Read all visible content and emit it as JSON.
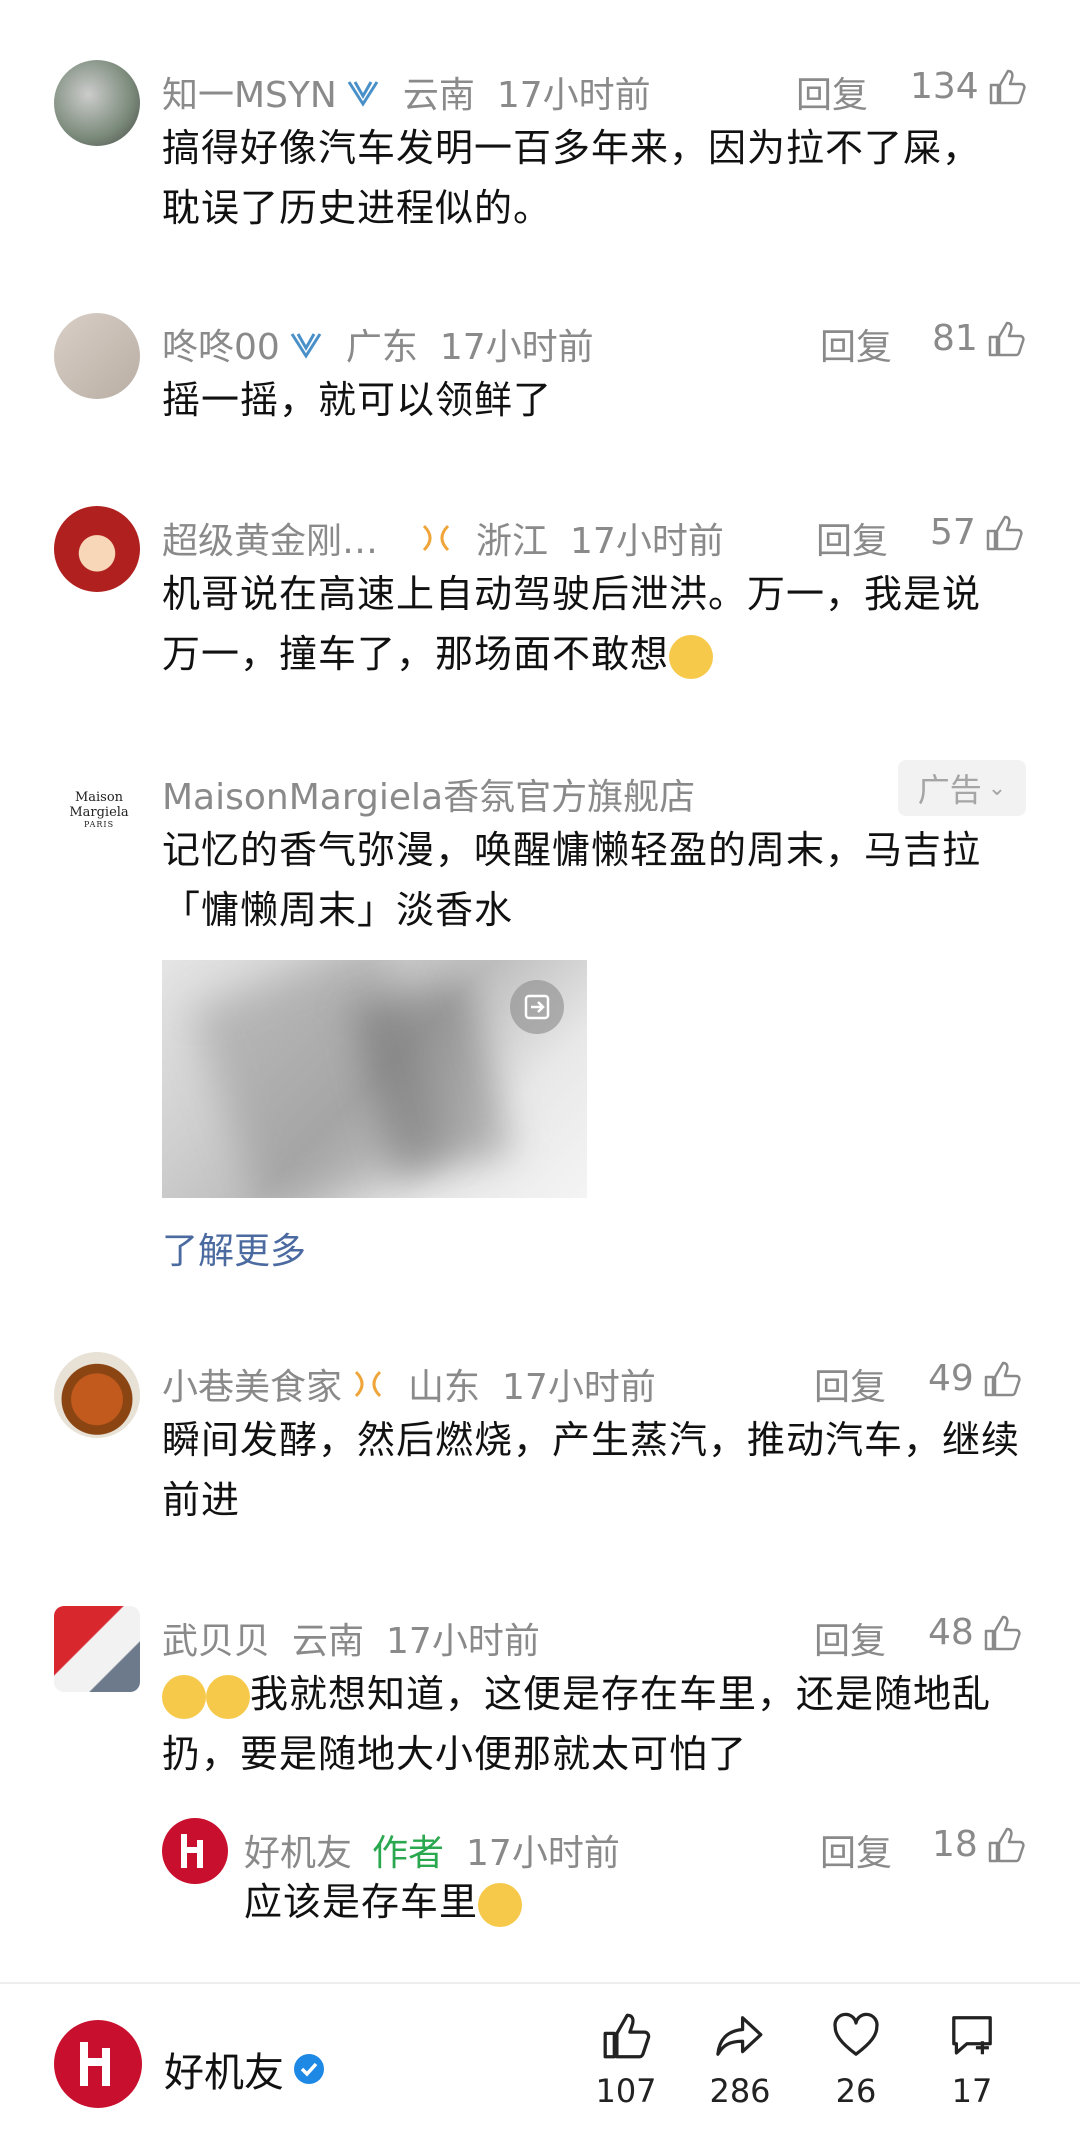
{
  "comments": [
    {
      "name": "知一MSYN",
      "region": "云南",
      "time": "17小时前",
      "reply": "回复",
      "likes": "134",
      "text1": "搞得好像汽车发明一百多年来，因为拉不了屎，",
      "text2": "耽误了历史进程似的。"
    },
    {
      "name": "咚咚00",
      "region": "广东",
      "time": "17小时前",
      "reply": "回复",
      "likes": "81",
      "text1": "摇一摇，就可以领鲜了"
    },
    {
      "name": "超级黄金刚…",
      "region": "浙江",
      "time": "17小时前",
      "reply": "回复",
      "likes": "57",
      "text1": "机哥说在高速上自动驾驶后泄洪。万一，我是说",
      "text2": "万一，撞车了，那场面不敢想"
    },
    {
      "name": "小巷美食家",
      "region": "山东",
      "time": "17小时前",
      "reply": "回复",
      "likes": "49",
      "text1": "瞬间发酵，然后燃烧，产生蒸汽，推动汽车，继续",
      "text2": "前进"
    },
    {
      "name": "武贝贝",
      "region": "云南",
      "time": "17小时前",
      "reply": "回复",
      "likes": "48",
      "text1": "我就想知道，这便是存在车里，还是随地乱",
      "text2": "扔，要是随地大小便那就太可怕了"
    }
  ],
  "ad": {
    "brand": "MaisonMargiela香氛官方旗舰店",
    "logo_line1": "Maison Margiela",
    "logo_line2": "PARIS",
    "badge": "广告",
    "text1": "记忆的香气弥漫，唤醒慵懒轻盈的周末，马吉拉",
    "text2": "「慵懒周末」淡香水",
    "learn_more": "了解更多"
  },
  "subreply": {
    "name": "好机友",
    "tag": "作者",
    "time": "17小时前",
    "reply": "回复",
    "likes": "18",
    "text": "应该是存车里"
  },
  "bottom": {
    "account": "好机友",
    "likes": "107",
    "shares": "286",
    "favorites": "26",
    "comments": "17"
  },
  "colors": {
    "accent": "#2aa84f",
    "link": "#4a6aa0",
    "brand": "#c8102e",
    "verified": "#1e88e5"
  }
}
